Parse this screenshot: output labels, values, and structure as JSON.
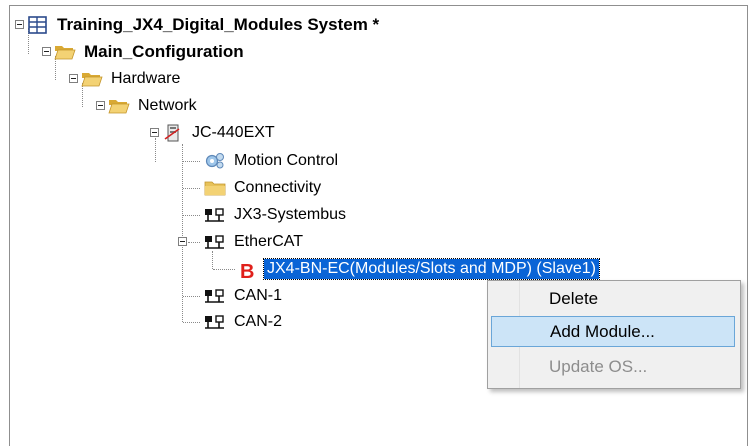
{
  "tree": {
    "root": "Training_JX4_Digital_Modules System *",
    "main_config": "Main_Configuration",
    "hardware": "Hardware",
    "network": "Network",
    "controller": "JC-440EXT",
    "motion_control": "Motion Control",
    "connectivity": "Connectivity",
    "systembus": "JX3-Systembus",
    "ethercat": "EtherCAT",
    "slave": "JX4-BN-EC(Modules/Slots and MDP) (Slave1)",
    "can1": "CAN-1",
    "can2": "CAN-2"
  },
  "context_menu": {
    "delete": "Delete",
    "add_module": "Add Module...",
    "update_os": "Update OS..."
  },
  "colors": {
    "selection": "#0a64d6",
    "menu_highlight": "#cce4f7",
    "error_marker": "#e0201b",
    "folder": "#e7c25a"
  }
}
